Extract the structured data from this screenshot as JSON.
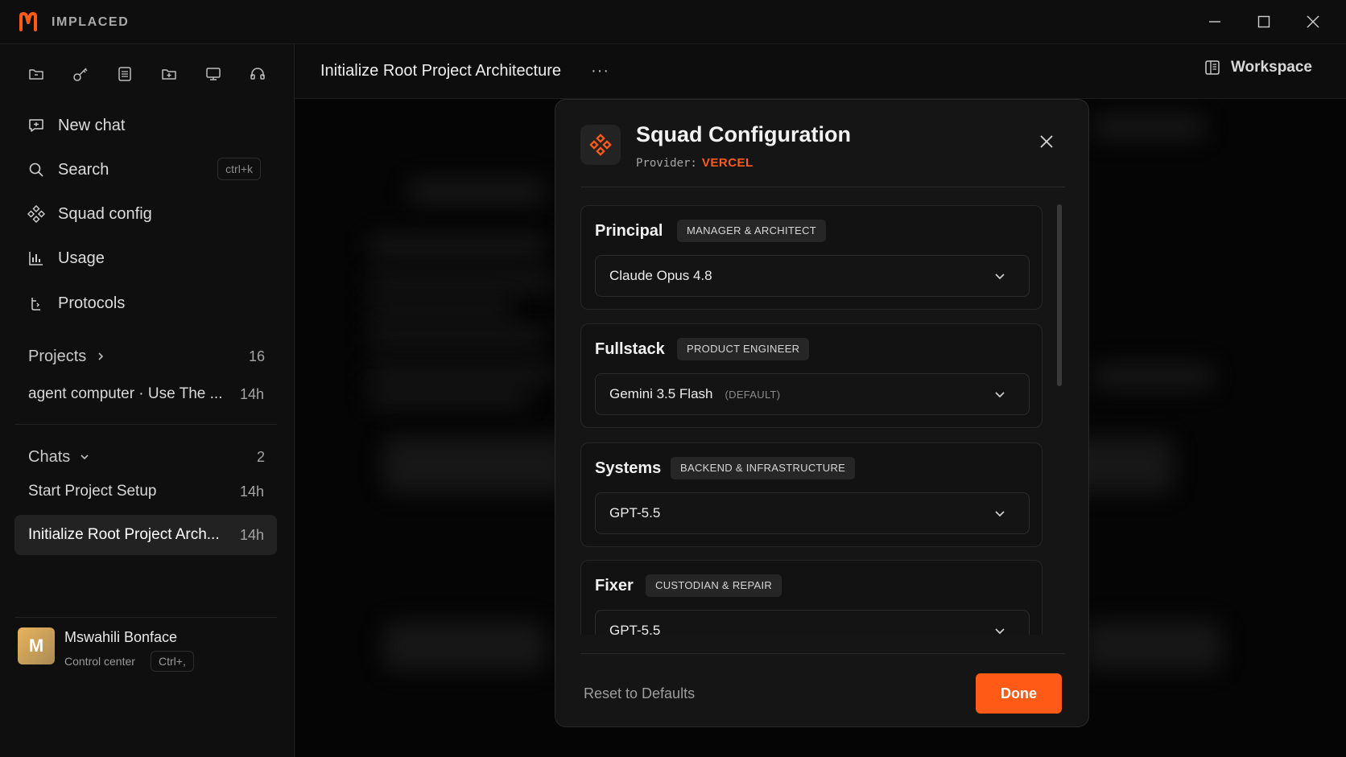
{
  "app": {
    "name": "IMPLACED",
    "brand_color": "#ff5a16"
  },
  "window_controls": [
    "minimize-icon",
    "maximize-icon",
    "close-icon"
  ],
  "sidebar": {
    "quick_actions": [
      "folder-icon",
      "key-icon",
      "table-icon",
      "folder-add-icon",
      "monitor-icon",
      "headset-icon"
    ],
    "nav": [
      {
        "label": "New chat",
        "icon": "chat-icon"
      },
      {
        "label": "Search",
        "icon": "search-icon",
        "shortcut": "ctrl+k"
      },
      {
        "label": "Squad config",
        "icon": "squad-icon"
      },
      {
        "label": "Usage",
        "icon": "bar-chart-icon"
      },
      {
        "label": "Protocols",
        "icon": "protocol-icon"
      }
    ],
    "projects": {
      "label": "Projects",
      "count": "16",
      "items": [
        {
          "title": "agent computer · Use The ...",
          "time": "14h"
        }
      ]
    },
    "chats": {
      "label": "Chats",
      "count": "2",
      "items": [
        {
          "title": "Start Project Setup",
          "time": "14h"
        },
        {
          "title": "Initialize Root Project Arch...",
          "time": "14h",
          "active": true
        }
      ]
    },
    "user": {
      "initial": "M",
      "name": "Mswahili Bonface",
      "subtitle": "Control center",
      "shortcut": "Ctrl+,"
    }
  },
  "header": {
    "title": "Initialize Root Project Architecture",
    "more": "···",
    "workspace_label": "Workspace"
  },
  "modal": {
    "title": "Squad Configuration",
    "provider_label": "Provider:",
    "provider_value": "VERCEL",
    "roles": [
      {
        "name": "Principal",
        "tag": "MANAGER & ARCHITECT",
        "model": "Claude Opus 4.8",
        "note": ""
      },
      {
        "name": "Fullstack",
        "tag": "PRODUCT ENGINEER",
        "model": "Gemini 3.5 Flash",
        "note": "(DEFAULT)"
      },
      {
        "name": "Systems",
        "tag": "BACKEND & INFRASTRUCTURE",
        "model": "GPT-5.5",
        "note": ""
      },
      {
        "name": "Fixer",
        "tag": "CUSTODIAN & REPAIR",
        "model": "GPT-5.5",
        "note": ""
      }
    ],
    "reset_label": "Reset to Defaults",
    "done_label": "Done"
  }
}
